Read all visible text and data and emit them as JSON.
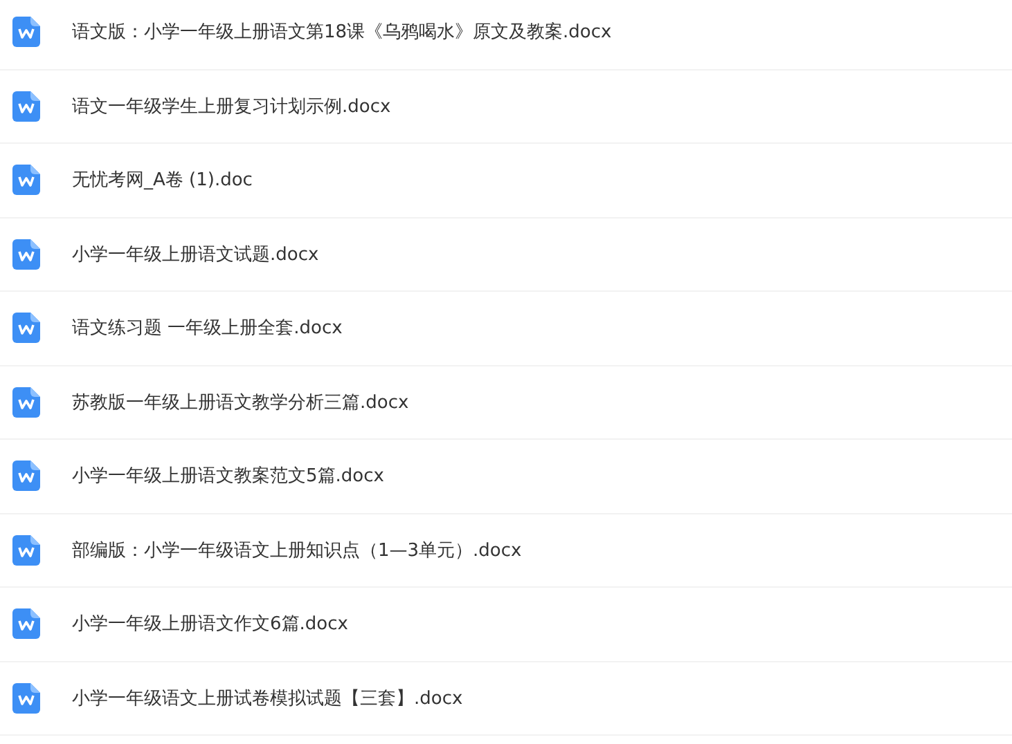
{
  "files": [
    {
      "name": "语文版：小学一年级上册语文第18课《乌鸦喝水》原文及教案.docx"
    },
    {
      "name": "语文一年级学生上册复习计划示例.docx"
    },
    {
      "name": "无忧考网_A卷 (1).doc"
    },
    {
      "name": "小学一年级上册语文试题.docx"
    },
    {
      "name": "语文练习题 一年级上册全套.docx"
    },
    {
      "name": "苏教版一年级上册语文教学分析三篇.docx"
    },
    {
      "name": "小学一年级上册语文教案范文5篇.docx"
    },
    {
      "name": "部编版：小学一年级语文上册知识点（1—3单元）.docx"
    },
    {
      "name": "小学一年级上册语文作文6篇.docx"
    },
    {
      "name": "小学一年级语文上册试卷模拟试题【三套】.docx"
    }
  ]
}
